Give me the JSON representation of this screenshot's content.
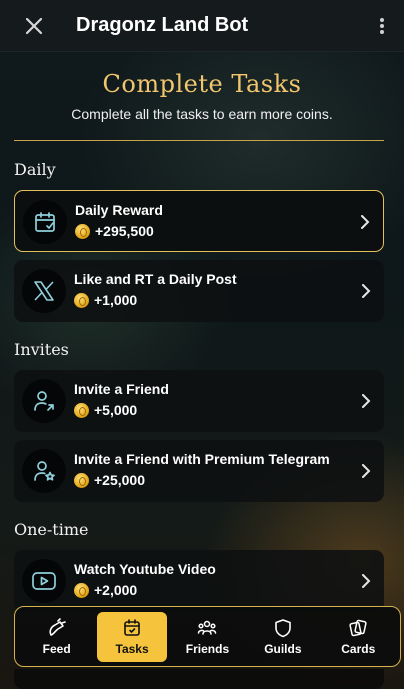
{
  "header": {
    "title": "Dragonz Land Bot",
    "close_icon": "close-icon",
    "more_icon": "more-vertical-icon"
  },
  "hero": {
    "title": "Complete Tasks",
    "subtitle": "Complete all the tasks to earn more coins."
  },
  "sections": {
    "daily": "Daily",
    "invites": "Invites",
    "one_time": "One-time"
  },
  "tasks": [
    {
      "title": "Daily Reward",
      "reward": "+295,500",
      "icon": "calendar-check-icon",
      "active": true
    },
    {
      "title": "Like and RT a Daily Post",
      "reward": "+1,000",
      "icon": "x-logo-icon",
      "active": false
    },
    {
      "title": "Invite a Friend",
      "reward": "+5,000",
      "icon": "user-arrow-icon",
      "active": false
    },
    {
      "title": "Invite a Friend with Premium Telegram",
      "reward": "+25,000",
      "icon": "user-star-icon",
      "active": false
    },
    {
      "title": "Watch Youtube Video",
      "reward": "+2,000",
      "icon": "play-icon",
      "active": false
    }
  ],
  "nav": [
    {
      "label": "Feed",
      "icon": "feed-icon",
      "active": false
    },
    {
      "label": "Tasks",
      "icon": "tasks-icon",
      "active": true
    },
    {
      "label": "Friends",
      "icon": "friends-icon",
      "active": false
    },
    {
      "label": "Guilds",
      "icon": "shield-icon",
      "active": false
    },
    {
      "label": "Cards",
      "icon": "cards-icon",
      "active": false
    }
  ],
  "colors": {
    "accent": "#f5c43c",
    "title_gold": "#f2c66d",
    "border_gold": "#d7b14e",
    "icon_cyan": "#8fd0dc"
  }
}
